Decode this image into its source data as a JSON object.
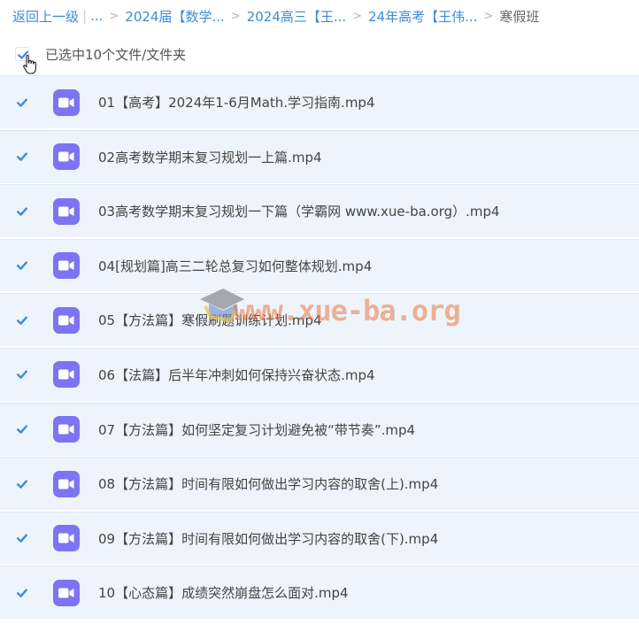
{
  "breadcrumb": {
    "back": "返回上一级",
    "ellipsis": "...",
    "items": [
      "2024届【数学...",
      "2024高三【王...",
      "24年高考【王伟..."
    ],
    "current": "寒假班"
  },
  "selection": {
    "label": "已选中10个文件/文件夹",
    "checked": true
  },
  "files": [
    {
      "name": "01【高考】2024年1-6月Math.学习指南.mp4",
      "checked": true
    },
    {
      "name": "02高考数学期末复习规划一上篇.mp4",
      "checked": true
    },
    {
      "name": "03高考数学期末复习规划一下篇（学霸网 www.xue-ba.org）.mp4",
      "checked": true
    },
    {
      "name": "04[规划篇]高三二轮总复习如何整体规划.mp4",
      "checked": true
    },
    {
      "name": "05【方法篇】寒假刷题训练计划.mp4",
      "checked": true
    },
    {
      "name": "06【法篇】后半年冲刺如何保持兴奋状态.mp4",
      "checked": true
    },
    {
      "name": "07【方法篇】如何坚定复习计划避免被“带节奏”.mp4",
      "checked": true
    },
    {
      "name": "08【方法篇】时间有限如何做出学习内容的取舍(上).mp4",
      "checked": true
    },
    {
      "name": "09【方法篇】时间有限如何做出学习内容的取舍(下).mp4",
      "checked": true
    },
    {
      "name": "10【心态篇】成绩突然崩盘怎么面对.mp4",
      "checked": true
    }
  ],
  "watermark": "www.xue-ba.org",
  "colors": {
    "link": "#3b8cd9",
    "row_selected_bg": "#edf4fc",
    "video_icon_bg": "#7c74f2",
    "checkbox": "#3b8cd9"
  },
  "icons": {
    "file": "video-file-icon",
    "check": "checkmark-icon"
  }
}
